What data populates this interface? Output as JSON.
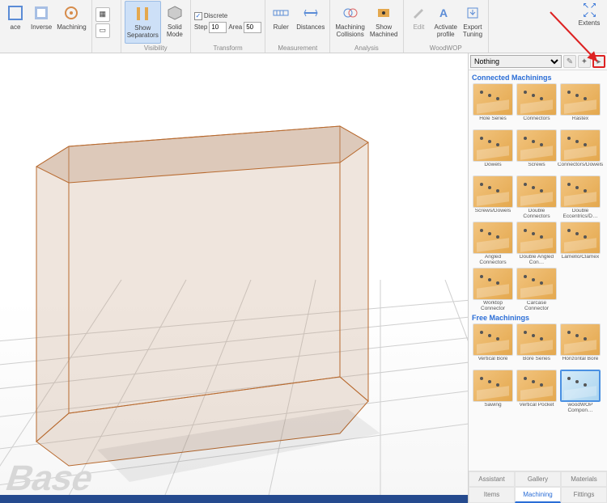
{
  "ribbon": {
    "face": "ace",
    "inverse": "Inverse",
    "machining": "Machining",
    "show_sep": "Show\nSeparators",
    "solid_mode": "Solid\nMode",
    "discrete": "Discrete",
    "step_label": "Step",
    "step_value": "10",
    "area_label": "Area",
    "area_value": "50",
    "ruler": "Ruler",
    "distances": "Distances",
    "mach_coll": "Machining\nCollisions",
    "show_mach": "Show\nMachined",
    "edit": "Edit",
    "activate": "Activate\nprofile",
    "export": "Export\nTuning",
    "extents": "Extents",
    "groups": {
      "visibility": "Visibility",
      "transform": "Transform",
      "measurement": "Measurement",
      "analysis": "Analysis",
      "woodwop": "WoodWOP"
    }
  },
  "panel": {
    "filter": "Nothing",
    "sections": {
      "connected": "Connected Machinings",
      "free": "Free Machinings"
    },
    "connected": [
      "Hole Series",
      "Connectors",
      "Rastex",
      "Dowels",
      "Screws",
      "Connectors/Dowels",
      "Screws/Dowels",
      "Double Connectors",
      "Double Eccentrics/D…",
      "Angled Connectors",
      "Double Angled Con…",
      "Lamello/Clamex",
      "Worktop Connector",
      "Carcase Connector"
    ],
    "free": [
      "Vertical Bore",
      "Bore Series",
      "Horizontal Bore",
      "Sawing",
      "Vertical Pocket",
      "woodWOP Compon…"
    ],
    "tabs": [
      "Assistant",
      "Gallery",
      "Materials",
      "Items",
      "Machining",
      "Fittings"
    ],
    "active_tab": "Machining",
    "selected_tile": "woodWOP Compon…"
  },
  "viewport": {
    "label": "Base"
  }
}
